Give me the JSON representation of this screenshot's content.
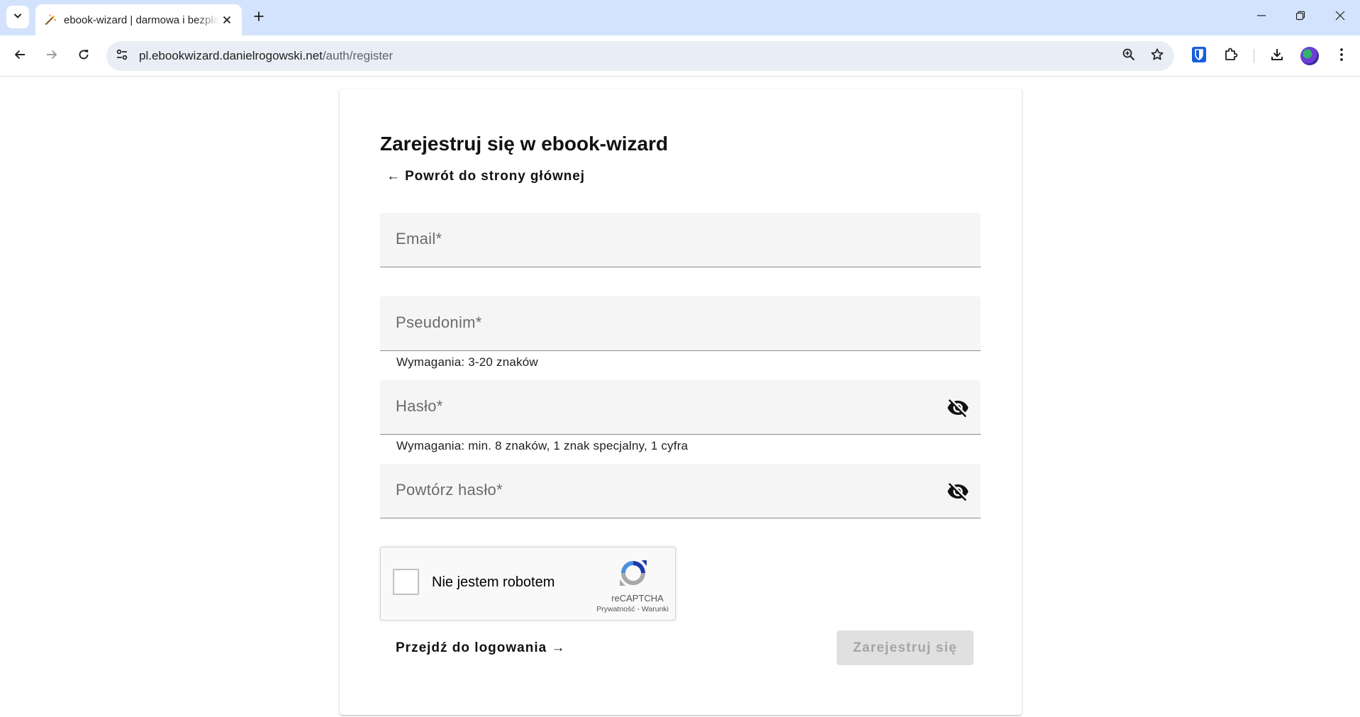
{
  "browser": {
    "tab_title": "ebook-wizard | darmowa i bezpłatna",
    "url_host": "pl.ebookwizard.danielrogowski.net",
    "url_path": "/auth/register"
  },
  "icons": {
    "tab_search": "chevron-down-icon",
    "favicon": "magic-wand-icon",
    "tab_close": "close-icon",
    "new_tab": "plus-icon",
    "minimize": "minimize-icon",
    "restore": "restore-icon",
    "close_window": "close-icon",
    "back": "arrow-left-icon",
    "forward": "arrow-right-icon",
    "reload": "reload-icon",
    "site_info": "tune-icon",
    "zoom": "zoom-in-icon",
    "bookmark": "star-icon",
    "password_manager": "bitwarden-shield-icon",
    "extensions": "puzzle-icon",
    "downloads": "download-icon",
    "profile": "avatar-icon",
    "menu": "more-vertical-icon",
    "visibility_off": "eye-off-icon",
    "recaptcha_logo": "recaptcha-icon"
  },
  "colors": {
    "tabstrip_bg": "#d3e3fd",
    "omnibox_bg": "#e9eef6",
    "field_bg": "#f5f5f5",
    "disabled_button_bg": "#e0e0e0",
    "disabled_button_text": "#a6a6a6",
    "bitwarden_blue": "#175ddc"
  },
  "register": {
    "title": "Zarejestruj się w ebook-wizard",
    "back_link": "← Powrót do strony głównej",
    "fields": {
      "email": {
        "label": "Email*",
        "value": ""
      },
      "nickname": {
        "label": "Pseudonim*",
        "value": "",
        "hint": "Wymagania: 3-20 znaków"
      },
      "password": {
        "label": "Hasło*",
        "value": "",
        "hint": "Wymagania: min. 8 znaków, 1 znak specjalny, 1 cyfra"
      },
      "password_repeat": {
        "label": "Powtórz hasło*",
        "value": ""
      }
    },
    "recaptcha": {
      "label": "Nie jestem robotem",
      "brand": "reCAPTCHA",
      "privacy": "Prywatność",
      "separator": " - ",
      "terms": "Warunki",
      "checked": false
    },
    "login_link": "Przejdź do logowania →",
    "submit_label": "Zarejestruj się",
    "submit_disabled": true
  }
}
